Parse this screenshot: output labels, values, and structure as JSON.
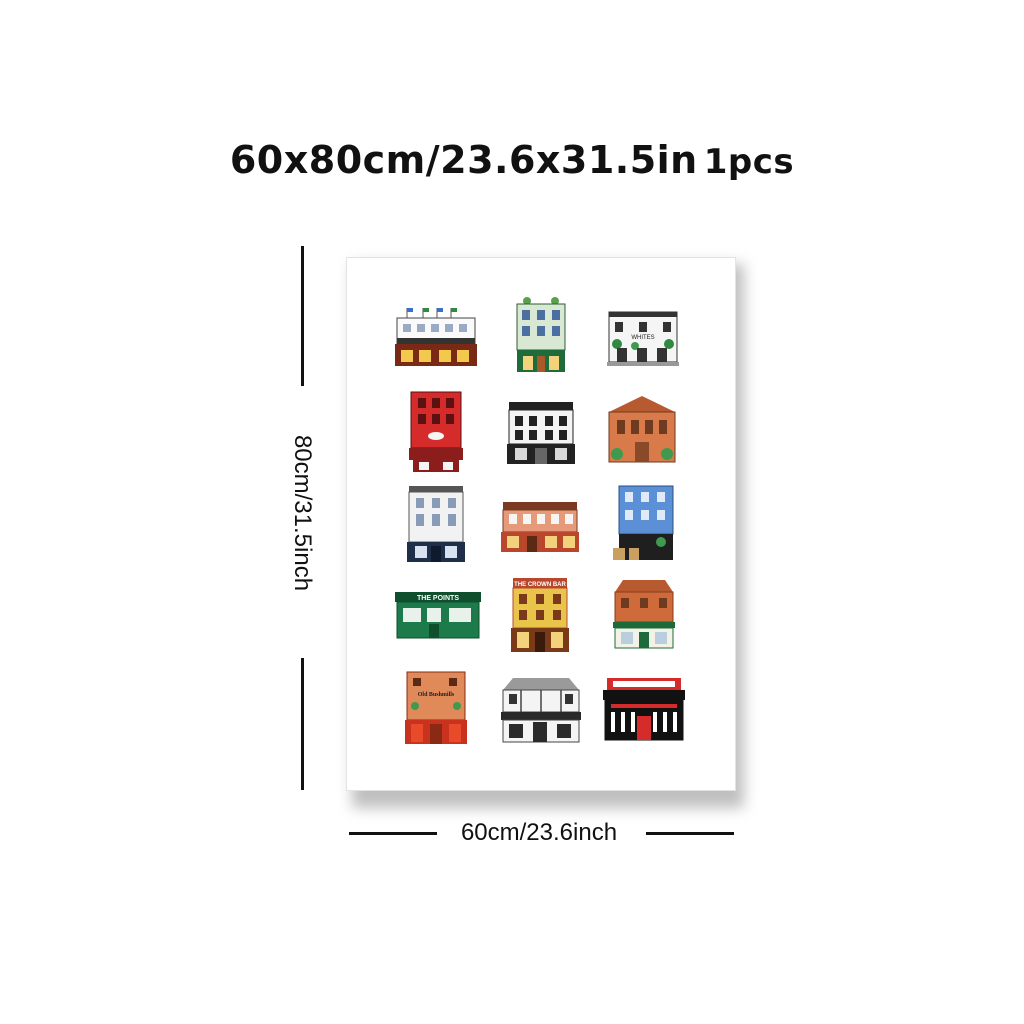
{
  "header": {
    "size_text": "60x80cm/23.6x31.5in",
    "quantity_text": "1pcs"
  },
  "dimensions": {
    "height_label": "80cm/31.5inch",
    "width_label": "60cm/23.6inch"
  },
  "canvas": {
    "background": "#ffffff",
    "buildings": [
      {
        "name": "building-tricolour-pub",
        "sign": "",
        "facade": "#ffffff",
        "ground": "#7a2a14",
        "trim": "#333333"
      },
      {
        "name": "building-green-pub",
        "sign": "",
        "facade": "#d9e8d2",
        "ground": "#1f6b3a",
        "trim": "#2d5d34"
      },
      {
        "name": "building-whites-tavern",
        "sign": "WHITES",
        "facade": "#f5f5f5",
        "ground": "#f0f0f0",
        "trim": "#333333"
      },
      {
        "name": "building-red-pub",
        "sign": "",
        "facade": "#d62b2b",
        "ground": "#8b1d1d",
        "trim": "#5b1111"
      },
      {
        "name": "building-kelly-pub",
        "sign": "",
        "facade": "#f4f4f4",
        "ground": "#222222",
        "trim": "#222222"
      },
      {
        "name": "building-brick-church",
        "sign": "",
        "facade": "#d87a4a",
        "ground": "#8a4a2a",
        "trim": "#6e3a20"
      },
      {
        "name": "building-white-townhouse",
        "sign": "",
        "facade": "#f2f2f2",
        "ground": "#1f2f4a",
        "trim": "#555555"
      },
      {
        "name": "building-brick-pub",
        "sign": "",
        "facade": "#e69a7a",
        "ground": "#b8472e",
        "trim": "#7a3a22"
      },
      {
        "name": "building-blue-tile-pub",
        "sign": "",
        "facade": "#5b8fd6",
        "ground": "#1f1f1f",
        "trim": "#2b4f80"
      },
      {
        "name": "building-the-points",
        "sign": "THE POINTS",
        "facade": "#1d7a4a",
        "ground": "#1d7a4a",
        "trim": "#0f4f2e"
      },
      {
        "name": "building-crown-bar",
        "sign": "THE CROWN BAR",
        "facade": "#e8c44a",
        "ground": "#7a3a1a",
        "trim": "#b8472e"
      },
      {
        "name": "building-corner-brick-pub",
        "sign": "",
        "facade": "#cf6b3a",
        "ground": "#f2f2e6",
        "trim": "#1d6b3a"
      },
      {
        "name": "building-old-bushmills",
        "sign": "Old Bushmills",
        "facade": "#e08a5a",
        "ground": "#c8321e",
        "trim": "#8a2a14"
      },
      {
        "name": "building-tudor-pub",
        "sign": "",
        "facade": "#f4f4f4",
        "ground": "#2a2a2a",
        "trim": "#444444"
      },
      {
        "name": "building-red-black-bar",
        "sign": "",
        "facade": "#d62b2b",
        "ground": "#111111",
        "trim": "#ffffff"
      }
    ]
  }
}
